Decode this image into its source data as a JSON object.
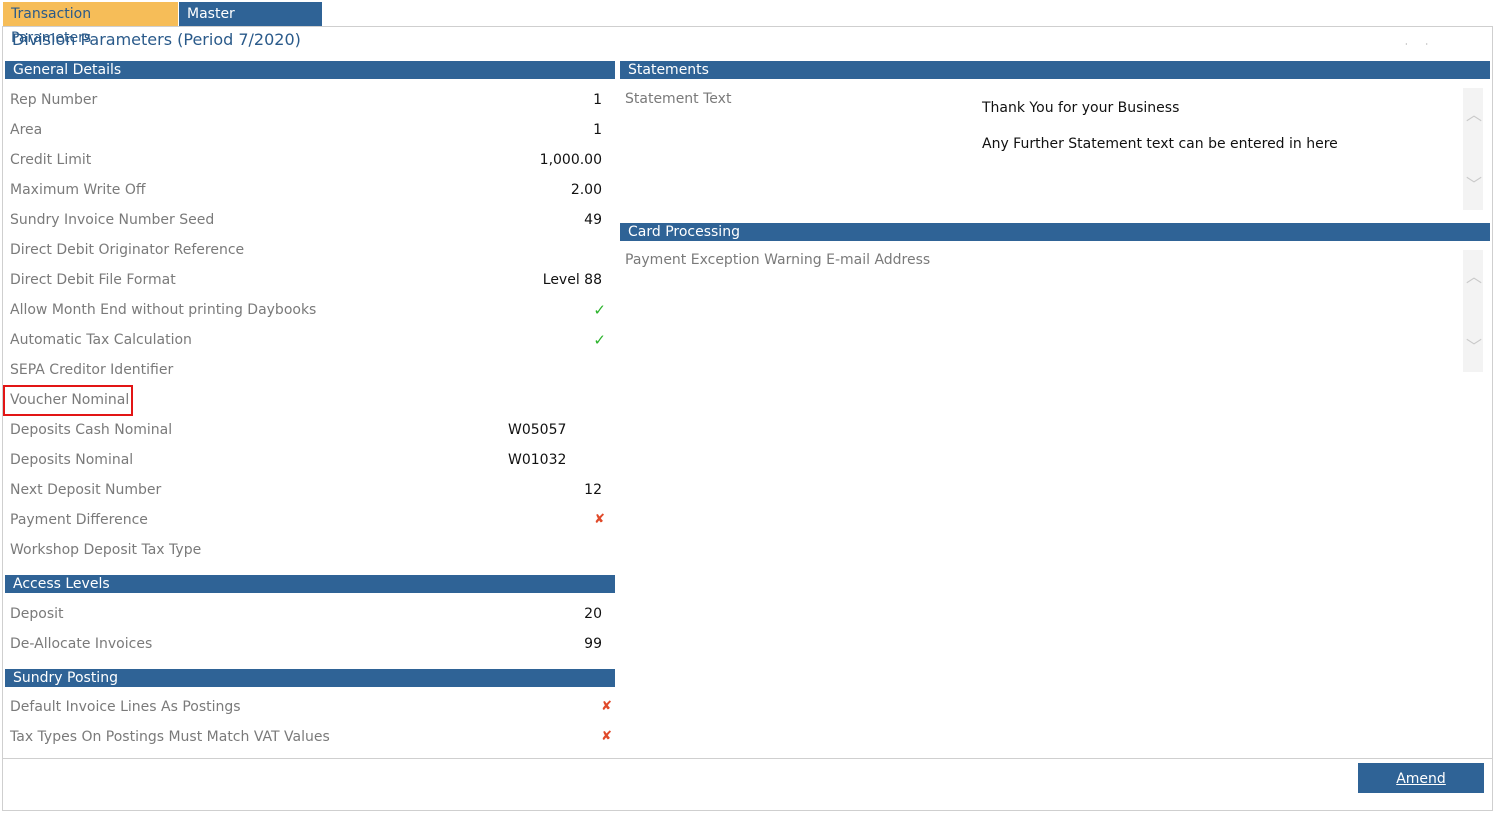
{
  "tabs": [
    {
      "label": "Transaction Parameters"
    },
    {
      "label": "Master Parameters"
    }
  ],
  "page_title": "Division Parameters (Period 7/2020)",
  "general": {
    "header": "General Details",
    "rows": [
      {
        "label": "Rep Number",
        "value": "1"
      },
      {
        "label": "Area",
        "value": "1"
      },
      {
        "label": "Credit Limit",
        "value": "1,000.00"
      },
      {
        "label": "Maximum Write Off",
        "value": "2.00"
      },
      {
        "label": "Sundry Invoice Number Seed",
        "value": "49"
      },
      {
        "label": "Direct Debit Originator Reference",
        "value": ""
      },
      {
        "label": "Direct Debit File Format",
        "value": "Level 88"
      },
      {
        "label": "Allow Month End without printing Daybooks",
        "value": "✓"
      },
      {
        "label": "Automatic Tax Calculation",
        "value": "✓"
      },
      {
        "label": "SEPA Creditor Identifier",
        "value": ""
      },
      {
        "label": "Voucher Nominal",
        "value": ""
      },
      {
        "label": "Deposits Cash Nominal",
        "value": "W05057"
      },
      {
        "label": "Deposits Nominal",
        "value": "W01032"
      },
      {
        "label": "Next Deposit Number",
        "value": "12"
      },
      {
        "label": "Payment Difference",
        "value": "✘"
      },
      {
        "label": "Workshop Deposit Tax Type",
        "value": ""
      }
    ]
  },
  "access": {
    "header": "Access Levels",
    "rows": [
      {
        "label": "Deposit",
        "value": "20"
      },
      {
        "label": "De-Allocate Invoices",
        "value": "99"
      }
    ]
  },
  "sundry": {
    "header": "Sundry Posting",
    "rows": [
      {
        "label": "Default Invoice Lines As Postings",
        "value": "✘"
      },
      {
        "label": "Tax Types On Postings Must Match VAT Values",
        "value": "✘"
      }
    ]
  },
  "statements": {
    "header": "Statements",
    "label": "Statement Text",
    "line1": "Thank You for your Business",
    "line2": "Any Further Statement text can be entered in here"
  },
  "card": {
    "header": "Card Processing",
    "label": "Payment Exception Warning E-mail Address"
  },
  "footer": {
    "amend_label": "Amend"
  },
  "colors": {
    "header_blue": "#2f6396",
    "tab_active": "#f6bd58",
    "check_green": "#2bb42b",
    "cross_red": "#e04a2a",
    "highlight_red": "#e21515"
  }
}
